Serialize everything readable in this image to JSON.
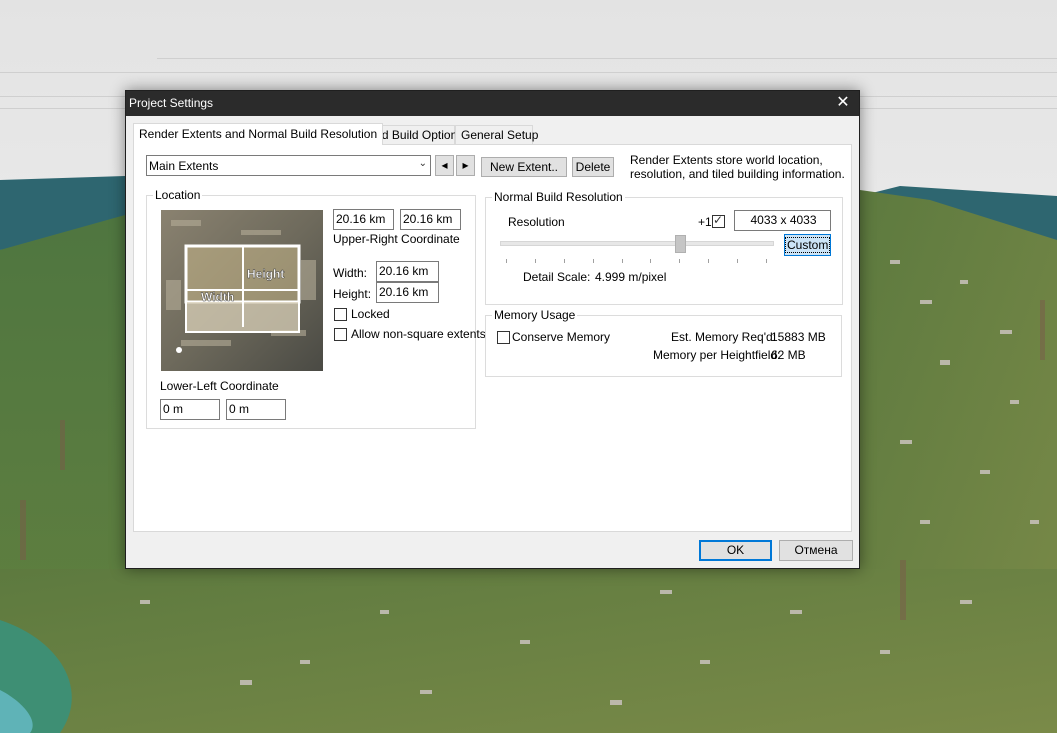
{
  "dialog": {
    "title": "Project Settings",
    "close_glyph": "✕"
  },
  "tabs": [
    {
      "label": "Render Extents and Normal Build Resolution",
      "active": true
    },
    {
      "label": "Tiled Build Options",
      "active": false
    },
    {
      "label": "General Setup",
      "active": false
    }
  ],
  "extents": {
    "selected": "Main Extents",
    "prev_glyph": "◂",
    "next_glyph": "▸",
    "new_label": "New Extent..",
    "delete_label": "Delete",
    "info": "Render Extents store world location, resolution, and tiled building information.",
    "info_line1": "Render Extents store world location,",
    "info_line2": "resolution, and tiled building information."
  },
  "location": {
    "legend": "Location",
    "diagram_width_label": "Width",
    "diagram_height_label": "Height",
    "ur_x": "20.16 km",
    "ur_y": "20.16 km",
    "ur_label": "Upper-Right Coordinate",
    "width_label": "Width:",
    "width_value": "20.16 km",
    "height_label": "Height:",
    "height_value": "20.16 km",
    "locked_label": "Locked",
    "locked_checked": false,
    "nonsquare_label": "Allow non-square extents",
    "nonsquare_checked": false,
    "ll_label": "Lower-Left Coordinate",
    "ll_x": "0 m",
    "ll_y": "0 m"
  },
  "resolution": {
    "legend": "Normal Build Resolution",
    "label": "Resolution",
    "plus_one_label": "+1",
    "plus_one_checked": true,
    "value": "4033 x 4033",
    "custom_label": "Custom",
    "slider_position": 0.66,
    "detail_label": "Detail Scale:",
    "detail_value": "4.999 m/pixel"
  },
  "memory": {
    "legend": "Memory Usage",
    "conserve_label": "Conserve Memory",
    "conserve_checked": false,
    "req_label": "Est. Memory Req'd:",
    "req_value": "15883 MB",
    "per_label": "Memory per Heightfield:",
    "per_value": "62 MB"
  },
  "footer": {
    "ok_label": "OK",
    "cancel_label": "Отмена"
  },
  "colors": {
    "titlebar": "#2b2b2b",
    "focus_blue": "#0078d7",
    "custom_bg": "#cce4f7",
    "terrain_green": "#5d7c3e",
    "sea": "#2f6670"
  }
}
